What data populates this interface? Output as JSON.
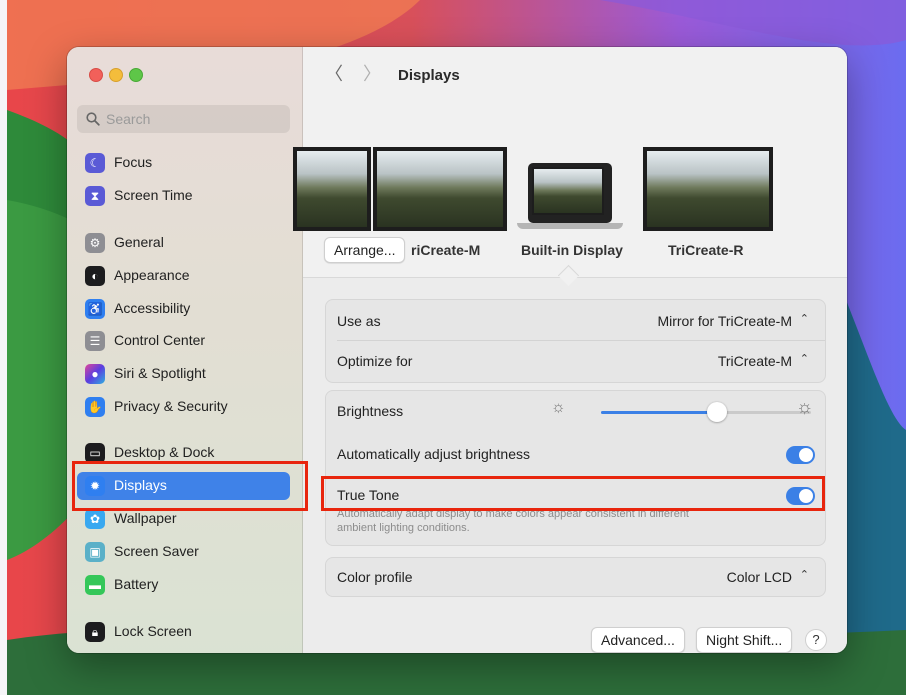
{
  "window": {
    "title": "Displays"
  },
  "search": {
    "placeholder": "Search"
  },
  "sidebar": {
    "items": [
      {
        "label": "Focus",
        "icon": "moon-icon",
        "color": "#5a5ad6"
      },
      {
        "label": "Screen Time",
        "icon": "hourglass-icon",
        "color": "#5a5ad6"
      },
      {
        "label": "General",
        "icon": "gear-icon",
        "color": "#8e8e93"
      },
      {
        "label": "Appearance",
        "icon": "appearance-icon",
        "color": "#1c1c1e"
      },
      {
        "label": "Accessibility",
        "icon": "accessibility-icon",
        "color": "#2f7ff0"
      },
      {
        "label": "Control Center",
        "icon": "control-center-icon",
        "color": "#8e8e93"
      },
      {
        "label": "Siri & Spotlight",
        "icon": "siri-icon",
        "color": "#7a3ee0"
      },
      {
        "label": "Privacy & Security",
        "icon": "hand-icon",
        "color": "#2f7ff0"
      },
      {
        "label": "Desktop & Dock",
        "icon": "dock-icon",
        "color": "#1c1c1e"
      },
      {
        "label": "Displays",
        "icon": "sun-icon",
        "color": "#2f7ff0"
      },
      {
        "label": "Wallpaper",
        "icon": "flower-icon",
        "color": "#39a8f0"
      },
      {
        "label": "Screen Saver",
        "icon": "screensaver-icon",
        "color": "#5ab0c8"
      },
      {
        "label": "Battery",
        "icon": "battery-icon",
        "color": "#34c759"
      },
      {
        "label": "Lock Screen",
        "icon": "lock-icon",
        "color": "#1c1c1e"
      }
    ]
  },
  "displays": {
    "arrange_label": "Arrange...",
    "left_label": "riCreate-M",
    "center_label": "Built-in Display",
    "right_label": "TriCreate-R"
  },
  "settings": {
    "use_as_label": "Use as",
    "use_as_value": "Mirror for TriCreate-M",
    "optimize_label": "Optimize for",
    "optimize_value": "TriCreate-M",
    "brightness_label": "Brightness",
    "brightness_level": 0.55,
    "auto_brightness_label": "Automatically adjust brightness",
    "auto_brightness_on": true,
    "true_tone_label": "True Tone",
    "true_tone_on": true,
    "true_tone_desc_1": "Automatically adapt display to make colors appear consistent in different",
    "true_tone_desc_2": "ambient lighting conditions.",
    "color_profile_label": "Color profile",
    "color_profile_value": "Color LCD"
  },
  "footer": {
    "advanced_label": "Advanced...",
    "night_shift_label": "Night Shift...",
    "help_label": "?"
  },
  "colors": {
    "accent": "#3b80e6",
    "highlight": "#e8250d"
  }
}
